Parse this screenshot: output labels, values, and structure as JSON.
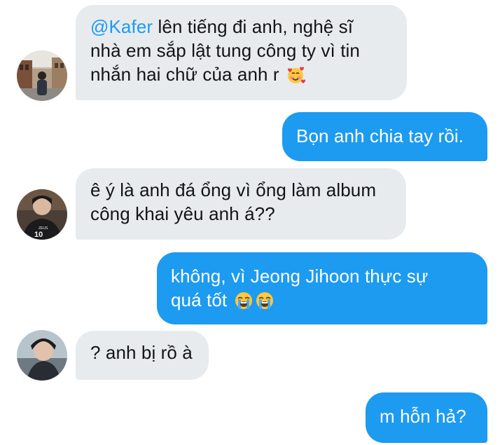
{
  "messages": [
    {
      "direction": "incoming",
      "mention": "@Kafer",
      "lines": [
        " lên tiếng đi anh, nghệ sĩ",
        "nhà em sắp lật tung công ty vì tin",
        "nhắn hai chữ của anh r"
      ],
      "emoji": [
        "smiling-face-with-hearts"
      ]
    },
    {
      "direction": "outgoing",
      "lines": [
        "Bọn anh chia tay rồi."
      ]
    },
    {
      "direction": "incoming",
      "lines": [
        "ê ý là anh đá ổng vì ổng làm album",
        "công khai yêu anh á??"
      ],
      "jersey_text": "ZEUS 10"
    },
    {
      "direction": "outgoing",
      "lines": [
        "không, vì Jeong Jihoon thực sự",
        "quá tốt"
      ],
      "emoji": [
        "loudly-crying-face",
        "loudly-crying-face"
      ]
    },
    {
      "direction": "incoming",
      "lines": [
        "? anh bị rồ à"
      ]
    },
    {
      "direction": "outgoing",
      "lines": [
        "m hỗn hả?"
      ]
    }
  ],
  "colors": {
    "incoming_bubble": "#e7ebee",
    "outgoing_bubble": "#1c9bf0",
    "mention": "#1d9bf0",
    "incoming_text": "#141414",
    "outgoing_text": "#ffffff"
  }
}
